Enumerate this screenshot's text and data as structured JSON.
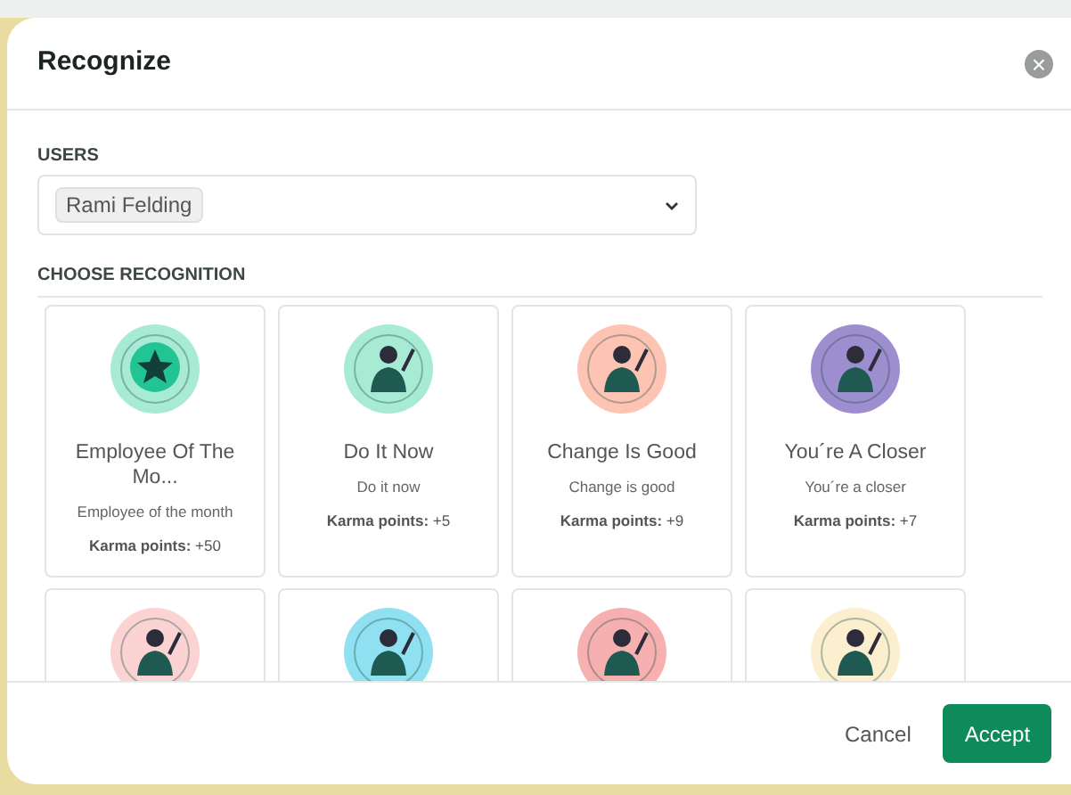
{
  "dialog": {
    "title": "Recognize",
    "close": "×"
  },
  "users": {
    "label": "USERS",
    "chips": [
      "Rami Felding"
    ]
  },
  "recognition": {
    "label": "CHOOSE RECOGNITION",
    "cards": [
      {
        "title": "Employee Of The Mo...",
        "subtitle": "Employee of the month",
        "points_label": "Karma points:",
        "points": "+50",
        "kind": "star",
        "color": "#a8ebd5"
      },
      {
        "title": "Do It Now",
        "subtitle": "Do it now",
        "points_label": "Karma points:",
        "points": "+5",
        "kind": "person",
        "color": "#a8ebd5"
      },
      {
        "title": "Change Is Good",
        "subtitle": "Change is good",
        "points_label": "Karma points:",
        "points": "+9",
        "kind": "person",
        "color": "#fdc4b4"
      },
      {
        "title": "You´re A Closer",
        "subtitle": "You´re a closer",
        "points_label": "Karma points:",
        "points": "+7",
        "kind": "person",
        "color": "#9d8fcf"
      },
      {
        "kind": "person",
        "color": "#fbd3d3"
      },
      {
        "kind": "person",
        "color": "#8fe0f0"
      },
      {
        "kind": "person",
        "color": "#f7b0b0"
      },
      {
        "kind": "person",
        "color": "#fbefcf"
      }
    ]
  },
  "buttons": [
    {
      "label": "Cancel",
      "kind": "secondary"
    },
    {
      "label": "Accept",
      "kind": "primary"
    }
  ]
}
